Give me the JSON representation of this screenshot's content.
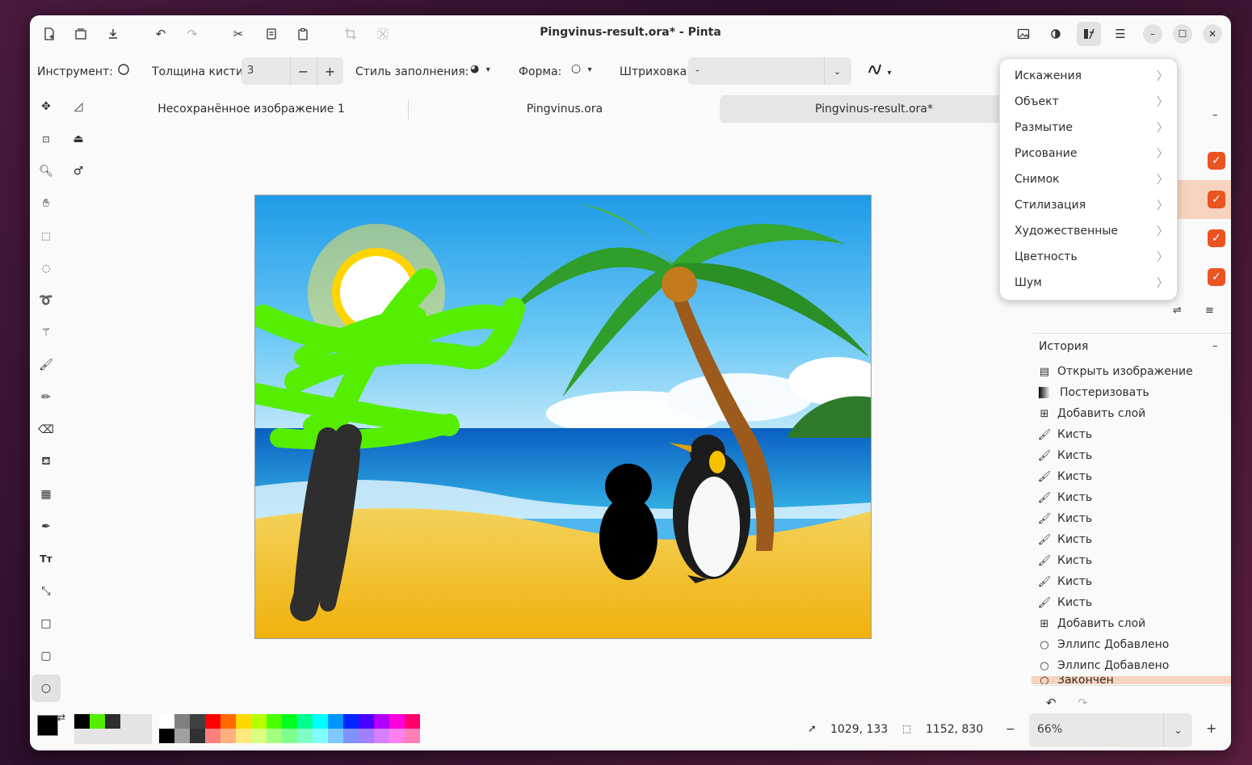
{
  "window": {
    "title": "Pingvinus-result.ora* - Pinta"
  },
  "toolbar": {
    "tool_label": "Инструмент:",
    "brush_width_label": "Толщина кисти:",
    "brush_width_value": "3",
    "fill_style_label": "Стиль заполнения:",
    "shape_label": "Форма:",
    "dash_label": "Штриховка:",
    "dash_value": "-"
  },
  "tabs": [
    {
      "label": "Несохранённое изображение 1"
    },
    {
      "label": "Pingvinus.ora"
    },
    {
      "label": "Pingvinus-result.ora*"
    }
  ],
  "adjustments_menu": {
    "items": [
      {
        "label": "Искажения"
      },
      {
        "label": "Объект"
      },
      {
        "label": "Размытие"
      },
      {
        "label": "Рисование"
      },
      {
        "label": "Снимок"
      },
      {
        "label": "Стилизация"
      },
      {
        "label": "Художественные"
      },
      {
        "label": "Цветность"
      },
      {
        "label": "Шум"
      }
    ]
  },
  "history": {
    "title": "История",
    "items": [
      {
        "label": "Открыть изображение",
        "icon": "open-image-icon"
      },
      {
        "label": "Постеризовать",
        "icon": "posterize-icon"
      },
      {
        "label": "Добавить слой",
        "icon": "add-layer-icon"
      },
      {
        "label": "Кисть",
        "icon": "brush-icon"
      },
      {
        "label": "Кисть",
        "icon": "brush-icon"
      },
      {
        "label": "Кисть",
        "icon": "brush-icon"
      },
      {
        "label": "Кисть",
        "icon": "brush-icon"
      },
      {
        "label": "Кисть",
        "icon": "brush-icon"
      },
      {
        "label": "Кисть",
        "icon": "brush-icon"
      },
      {
        "label": "Кисть",
        "icon": "brush-icon"
      },
      {
        "label": "Кисть",
        "icon": "brush-icon"
      },
      {
        "label": "Кисть",
        "icon": "brush-icon"
      },
      {
        "label": "Добавить слой",
        "icon": "add-layer-icon"
      },
      {
        "label": "Эллипс Добавлено",
        "icon": "ellipse-icon"
      },
      {
        "label": "Эллипс Добавлено",
        "icon": "ellipse-icon"
      },
      {
        "label": "Закончен",
        "icon": "ellipse-icon"
      }
    ]
  },
  "status": {
    "cursor_position": "1029, 133",
    "selection_size": "1152, 830",
    "zoom": "66%"
  },
  "palette": {
    "primary": "#000000",
    "secondary": "#ffffff",
    "recent": [
      "#000000",
      "#55ee00",
      "#2e2e2e"
    ],
    "top_row": [
      "#ffffff",
      "#808080",
      "#404040",
      "#ff0000",
      "#ff6a00",
      "#ffd800",
      "#b6ff00",
      "#4cff00",
      "#00ff21",
      "#00ff90",
      "#00ffff",
      "#0094ff",
      "#0026ff",
      "#4800ff",
      "#b200ff",
      "#ff00dc",
      "#ff006e"
    ],
    "bottom_row": [
      "#000000",
      "#a0a0a0",
      "#303030",
      "#ff7f7f",
      "#ffb27f",
      "#ffe97f",
      "#daff7f",
      "#a5ff7f",
      "#7fff8e",
      "#7fffc5",
      "#7fffff",
      "#7fc9ff",
      "#7f92ff",
      "#a17fff",
      "#d67fff",
      "#ff7fed",
      "#ff7fb6"
    ]
  }
}
